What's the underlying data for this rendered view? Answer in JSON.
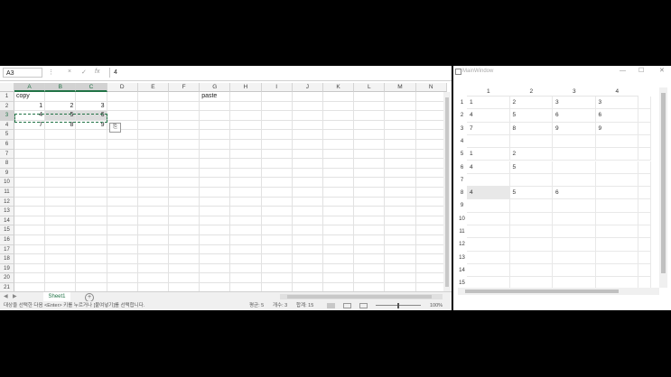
{
  "excel": {
    "namebox": "A3",
    "formula_value": "4",
    "formula_icons": [
      "×",
      "✓",
      "fx"
    ],
    "columns": [
      "A",
      "B",
      "C",
      "D",
      "E",
      "F",
      "G",
      "H",
      "I",
      "J",
      "K",
      "L",
      "M",
      "N"
    ],
    "rows": [
      "1",
      "2",
      "3",
      "4",
      "5",
      "6",
      "7",
      "8",
      "9",
      "10",
      "11",
      "12",
      "13",
      "14",
      "15",
      "16",
      "17",
      "18",
      "19",
      "20",
      "21"
    ],
    "cells": {
      "A1": "copy",
      "G1": "paste",
      "A2": "1",
      "B2": "2",
      "C2": "3",
      "A3": "4",
      "B3": "5",
      "C3": "6",
      "A4": "7",
      "B4": "8",
      "C4": "9"
    },
    "sheet_tab": "Sheet1",
    "add_sheet": "+",
    "status": {
      "message": "대상을 선택한 다음 <Enter> 키를 누르거나 [붙여넣기]를 선택합니다.",
      "average": "평균: 5",
      "count": "개수: 3",
      "sum": "합계: 15",
      "zoom": "100%"
    }
  },
  "main_window": {
    "title": "MainWindow",
    "controls": [
      "—",
      "☐",
      "✕"
    ],
    "col_headers": [
      "1",
      "2",
      "3",
      "4"
    ],
    "row_headers": [
      "1",
      "2",
      "3",
      "4",
      "5",
      "6",
      "7",
      "8",
      "9",
      "10",
      "11",
      "12",
      "13",
      "14",
      "15"
    ],
    "rows": [
      [
        "1",
        "2",
        "3",
        "3"
      ],
      [
        "4",
        "5",
        "6",
        "6"
      ],
      [
        "7",
        "8",
        "9",
        "9"
      ],
      [
        "",
        "",
        "",
        ""
      ],
      [
        "1",
        "2",
        "",
        ""
      ],
      [
        "4",
        "5",
        "",
        ""
      ],
      [
        "",
        "",
        "",
        ""
      ],
      [
        "4",
        "5",
        "6",
        ""
      ],
      [
        "",
        "",
        "",
        ""
      ],
      [
        "",
        "",
        "",
        ""
      ],
      [
        "",
        "",
        "",
        ""
      ],
      [
        "",
        "",
        "",
        ""
      ],
      [
        "",
        "",
        "",
        ""
      ],
      [
        "",
        "",
        "",
        ""
      ],
      [
        "",
        "",
        "",
        ""
      ]
    ]
  }
}
